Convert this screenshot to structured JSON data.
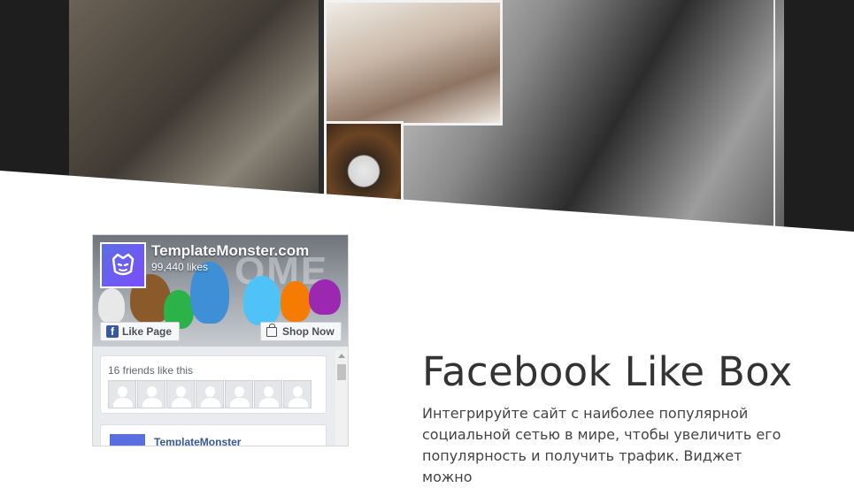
{
  "facebook_widget": {
    "page_name": "TemplateMonster.com",
    "likes": "99,440 likes",
    "cover_word": "OME",
    "like_page_label": "Like Page",
    "shop_now_label": "Shop Now",
    "friends_text": "16 friends like this",
    "post_author": "TemplateMonster"
  },
  "section": {
    "title": "Facebook Like Box",
    "description": "Интегрируйте сайт с наиболее популярной социальной сетью в мире, чтобы увеличить его популярность и получить трафик. Виджет можно"
  },
  "colors": {
    "facebook_blue": "#3b5998",
    "hero_dark": "#1e1e1e"
  }
}
